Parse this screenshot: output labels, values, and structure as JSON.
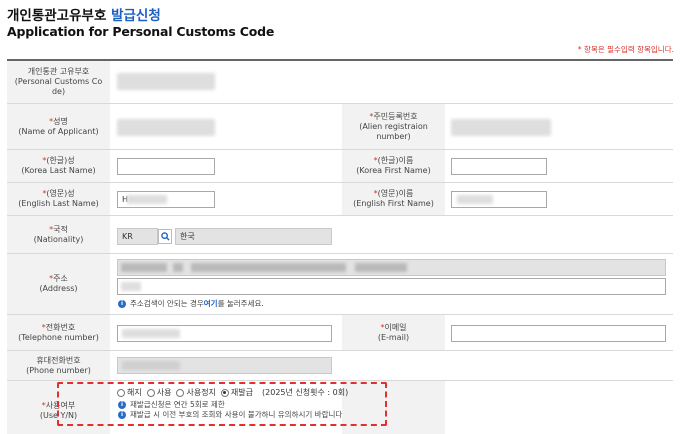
{
  "header": {
    "title_ko_prefix": "개인통관고유부호",
    "title_ko_accent": "발급신청",
    "title_en": "Application for Personal Customs Code",
    "required_note": "* 항목은 필수입력 항목입니다."
  },
  "fields": {
    "customs_code": {
      "ko": "개인통관 고유부호",
      "en": "(Personal Customs Code)"
    },
    "name": {
      "ko": "성명",
      "en": "(Name of Applicant)"
    },
    "alien_reg": {
      "ko": "주민등록번호",
      "en": "(Alien registraion number)"
    },
    "ko_last": {
      "ko": "(한글)성",
      "en": "(Korea Last Name)"
    },
    "ko_first": {
      "ko": "(한글)이름",
      "en": "(Korea First Name)"
    },
    "en_last": {
      "ko": "(영문)성",
      "en": "(English Last Name)"
    },
    "en_first": {
      "ko": "(영문)이름",
      "en": "(English First Name)"
    },
    "nationality": {
      "ko": "국적",
      "en": "(Nationality)",
      "code": "KR",
      "name": "한국"
    },
    "address": {
      "ko": "주소",
      "en": "(Address)"
    },
    "telephone": {
      "ko": "전화번호",
      "en": "(Telephone number)"
    },
    "email": {
      "ko": "이메일",
      "en": "(E-mail)"
    },
    "phone": {
      "ko": "휴대전화번호",
      "en": "(Phone number)"
    },
    "use": {
      "ko": "사용여부",
      "en": "(Use Y/N)"
    }
  },
  "address_help": {
    "before": "주소검색이 안되는 경우 ",
    "link": "여기",
    "after": "를 눌러주세요."
  },
  "en_last_partial": "H",
  "use_options": {
    "opt1": "해지",
    "opt2": "사용",
    "opt3": "사용정지",
    "opt4": "재발급",
    "selected": "재발급",
    "count_note": "(2025년 신청횟수 : 0회)",
    "info1": "재발급신청은 연간 5회로 제한",
    "info2": "재발급 시 이전 부호의 조회와 사용이 불가하니 유의하시기 바랍니다"
  },
  "asterisk": "*",
  "icons": {
    "search": "search-icon",
    "info": "info-icon"
  },
  "colors": {
    "accent": "#1a5fc6",
    "required": "#d6332a",
    "highlight": "#e03030"
  }
}
